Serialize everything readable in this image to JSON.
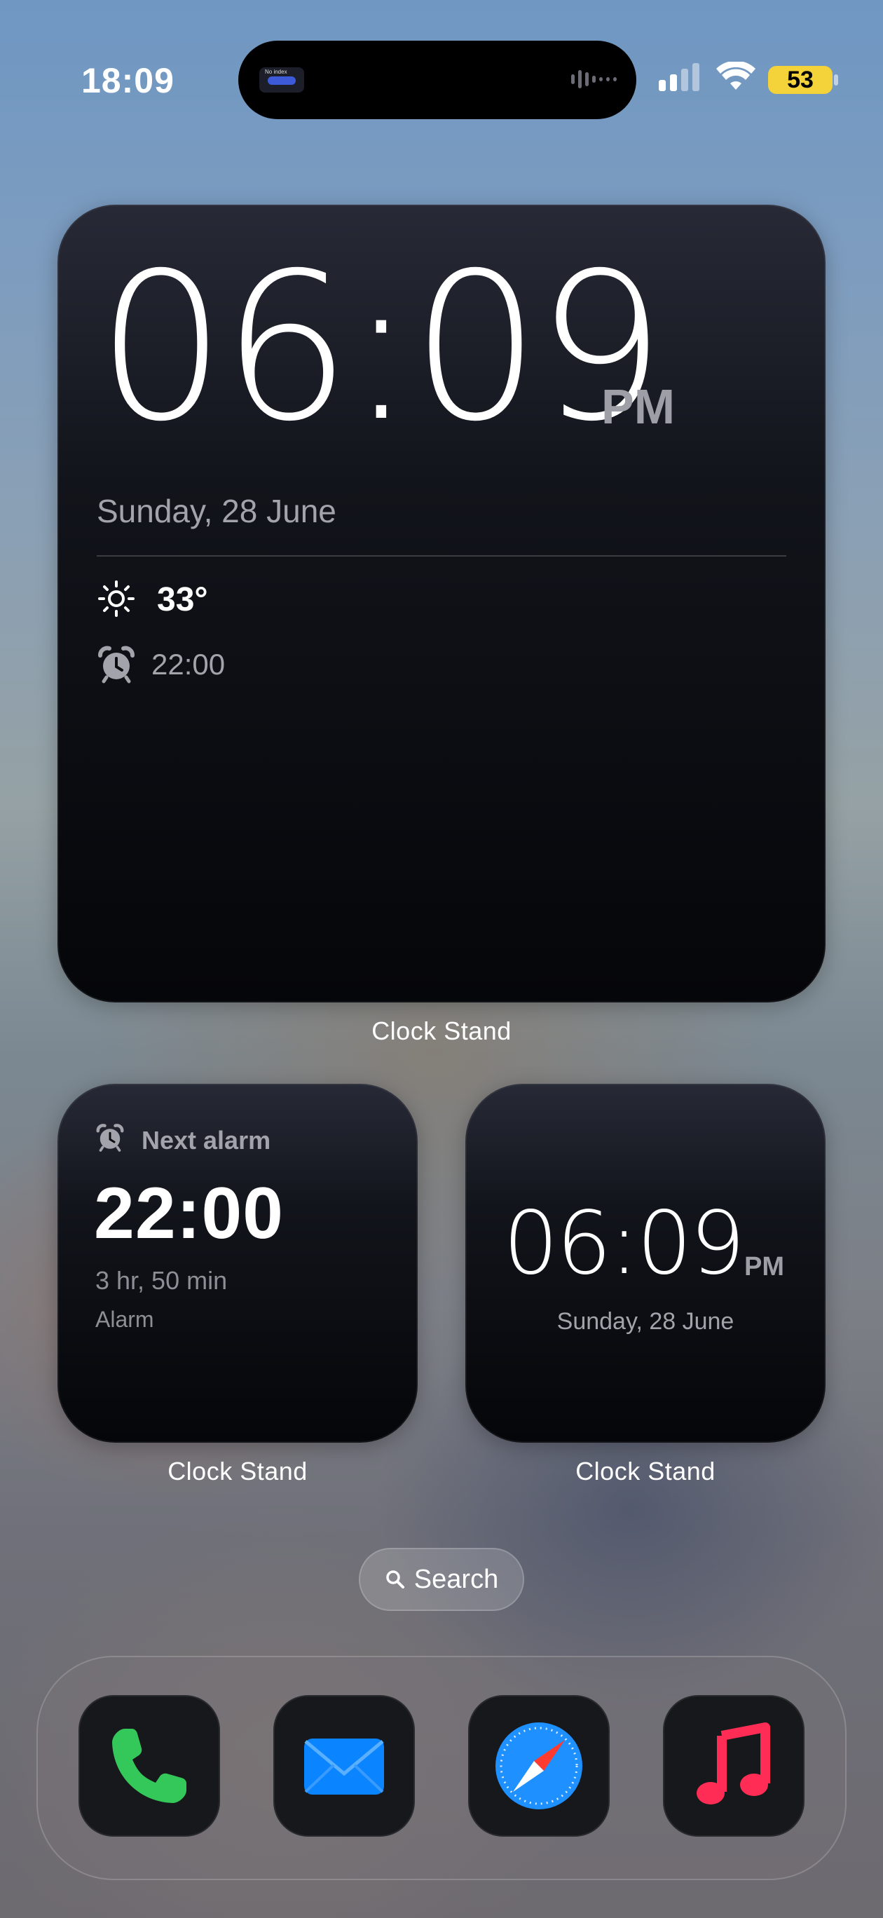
{
  "status_bar": {
    "time": "18:09",
    "battery": "53",
    "battery_color": "#f3d23a",
    "island_caption": "No index"
  },
  "widgets": {
    "large": {
      "time": "06:09",
      "ampm": "PM",
      "date": "Sunday, 28 June",
      "temperature": "33°",
      "alarm_time": "22:00",
      "label": "Clock Stand"
    },
    "next_alarm": {
      "title": "Next alarm",
      "time": "22:00",
      "remaining": "3 hr, 50 min",
      "alarm_name": "Alarm",
      "label": "Clock Stand"
    },
    "small_clock": {
      "time": "06:09",
      "ampm": "PM",
      "date": "Sunday, 28 June",
      "label": "Clock Stand"
    }
  },
  "search": {
    "label": "Search"
  },
  "dock": {
    "apps": [
      {
        "name": "Phone",
        "icon": "phone-icon",
        "color": "#34c759"
      },
      {
        "name": "Mail",
        "icon": "mail-icon",
        "color": "#0a84ff"
      },
      {
        "name": "Safari",
        "icon": "safari-icon",
        "color": "#1e90ff"
      },
      {
        "name": "Music",
        "icon": "music-icon",
        "color": "#ff2d55"
      }
    ]
  }
}
